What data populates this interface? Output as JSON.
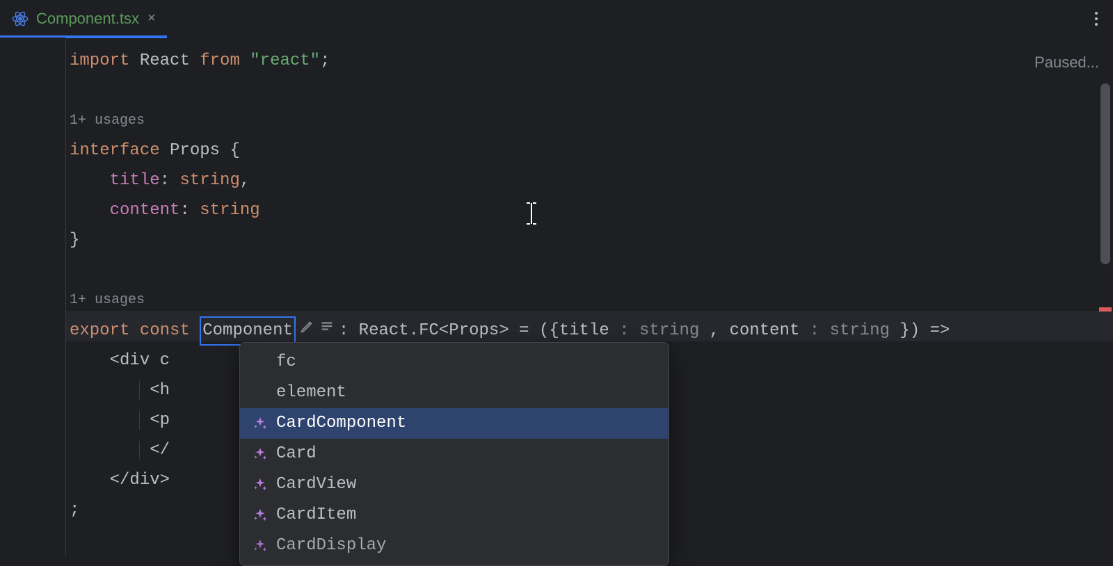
{
  "tab": {
    "filename": "Component.tsx",
    "close_glyph": "×"
  },
  "status": {
    "text": "Paused..."
  },
  "usages_label": "1+ usages",
  "code": {
    "import_kw": "import",
    "react_name": "React",
    "from_kw": "from",
    "react_str": "\"react\"",
    "semi": ";",
    "interface_kw": "interface",
    "props_name": "Props",
    "brace_open": "{",
    "brace_close": "}",
    "field_title": "title",
    "field_content": "content",
    "colon": ":",
    "string_t": "string",
    "comma": ",",
    "export_kw": "export",
    "const_kw": "const",
    "component_name": "Component",
    "fc_annotation": ": React.FC<Props> = ({title ",
    "hint_string": ": string",
    "comma_space": " , content ",
    "arrow_tail": " }) =>",
    "div_open": "<div c",
    "h_open": "<h",
    "p_open": "<p",
    "close_tag": "</",
    "div_close": "</div>",
    "trailing_semi": ";"
  },
  "rename_target": "Component",
  "completion": {
    "items": [
      {
        "label": "fc",
        "ai": false
      },
      {
        "label": "element",
        "ai": false
      },
      {
        "label": "CardComponent",
        "ai": true,
        "selected": true
      },
      {
        "label": "Card",
        "ai": true
      },
      {
        "label": "CardView",
        "ai": true
      },
      {
        "label": "CardItem",
        "ai": true
      },
      {
        "label": "CardDisplay",
        "ai": true
      }
    ]
  }
}
